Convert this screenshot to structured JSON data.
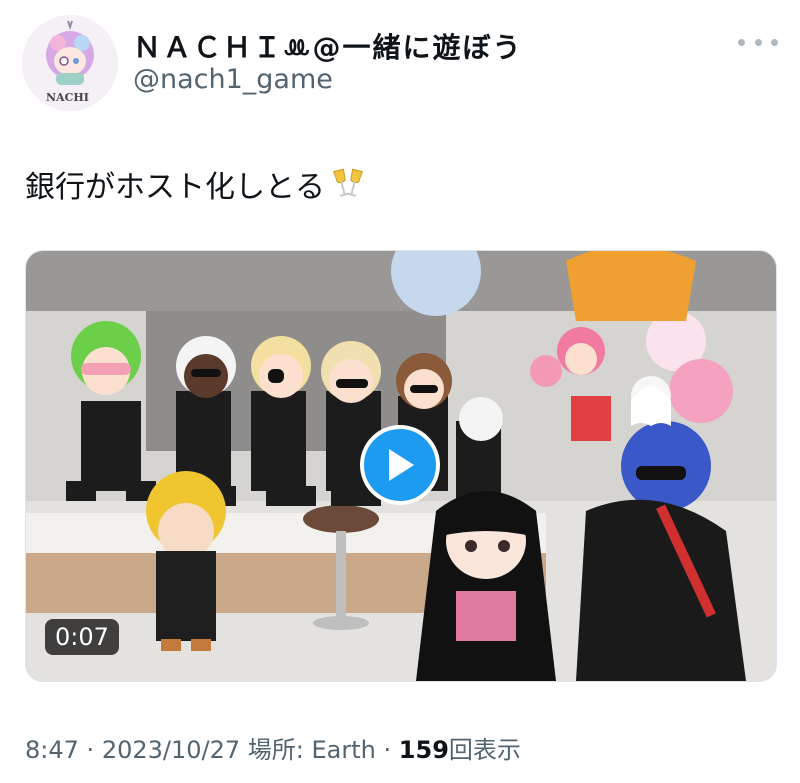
{
  "tweet": {
    "display_name": "ＮＡＣＨＩꔛ@一緒に遊ぼう",
    "handle": "@nach1_game",
    "avatar_text": "NACHI",
    "text": "銀行がホスト化しとる",
    "emoji": "clinking-glasses-icon",
    "video_duration": "0:07",
    "time": "8:47",
    "sep": "·",
    "date": "2023/10/27",
    "location_label": "場所: Earth",
    "views_count": "159",
    "views_label": "回表示"
  },
  "colors": {
    "accent": "#1d9bf0",
    "secondary_text": "#536471"
  }
}
